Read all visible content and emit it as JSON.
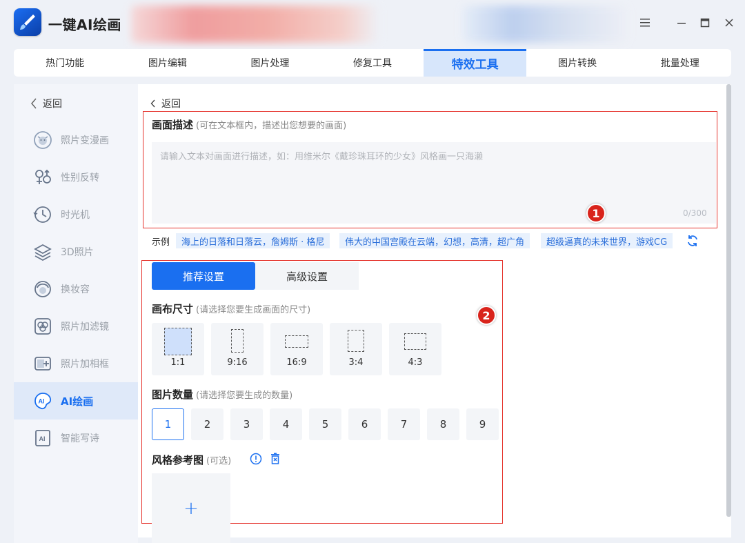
{
  "app": {
    "title": "一键AI绘画"
  },
  "window": {
    "menu_icon": "hamburger-icon",
    "minimize_icon": "minimize-icon",
    "maximize_icon": "maximize-icon",
    "close_icon": "close-icon"
  },
  "tabs": [
    {
      "label": "热门功能",
      "active": false
    },
    {
      "label": "图片编辑",
      "active": false
    },
    {
      "label": "图片处理",
      "active": false
    },
    {
      "label": "修复工具",
      "active": false
    },
    {
      "label": "特效工具",
      "active": true
    },
    {
      "label": "图片转换",
      "active": false
    },
    {
      "label": "批量处理",
      "active": false
    }
  ],
  "sidebar": {
    "back_label": "返回",
    "items": [
      {
        "label": "照片变漫画",
        "icon": "cartoon-face-icon",
        "active": false
      },
      {
        "label": "性别反转",
        "icon": "gender-icon",
        "active": false
      },
      {
        "label": "时光机",
        "icon": "clock-icon",
        "active": false
      },
      {
        "label": "3D照片",
        "icon": "layers-icon",
        "active": false
      },
      {
        "label": "换妆容",
        "icon": "makeup-face-icon",
        "active": false
      },
      {
        "label": "照片加滤镜",
        "icon": "filter-icon",
        "active": false
      },
      {
        "label": "照片加相框",
        "icon": "frame-icon",
        "active": false
      },
      {
        "label": "AI绘画",
        "icon": "ai-paint-icon",
        "active": true
      },
      {
        "label": "智能写诗",
        "icon": "ai-poem-icon",
        "active": false
      }
    ]
  },
  "main": {
    "back_label": "返回",
    "description": {
      "title": "画面描述",
      "hint": "(可在文本框内，描述出您想要的画面)",
      "placeholder": "请输入文本对画面进行描述，如：用维米尔《戴珍珠耳环的少女》风格画一只海濑",
      "value": "",
      "counter": "0/300"
    },
    "examples": {
      "label": "示例",
      "items": [
        "海上的日落和日落云，詹姆斯 · 格尼",
        "伟大的中国宫殿在云端，幻想，高清，超广角",
        "超级逼真的未来世界，游戏CG"
      ]
    },
    "settings_tabs": {
      "recommended": "推荐设置",
      "advanced": "高级设置",
      "active": "recommended"
    },
    "canvas_size": {
      "title": "画布尺寸",
      "hint": "(请选择您要生成画面的尺寸)",
      "options": [
        "1:1",
        "9:16",
        "16:9",
        "3:4",
        "4:3"
      ],
      "selected": "1:1"
    },
    "image_count": {
      "title": "图片数量",
      "hint": "(请选择您要生成的数量)",
      "options": [
        "1",
        "2",
        "3",
        "4",
        "5",
        "6",
        "7",
        "8",
        "9"
      ],
      "selected": "1"
    },
    "style_reference": {
      "title": "风格参考图",
      "hint": "(可选)",
      "info_icon": "info-icon",
      "delete_icon": "trash-icon",
      "upload_symbol": "+"
    }
  },
  "annotations": {
    "badge_1": "1",
    "badge_2": "2",
    "color": "#d9241c"
  },
  "colors": {
    "accent": "#1a6ff0",
    "annotation_red": "#e5332c"
  }
}
